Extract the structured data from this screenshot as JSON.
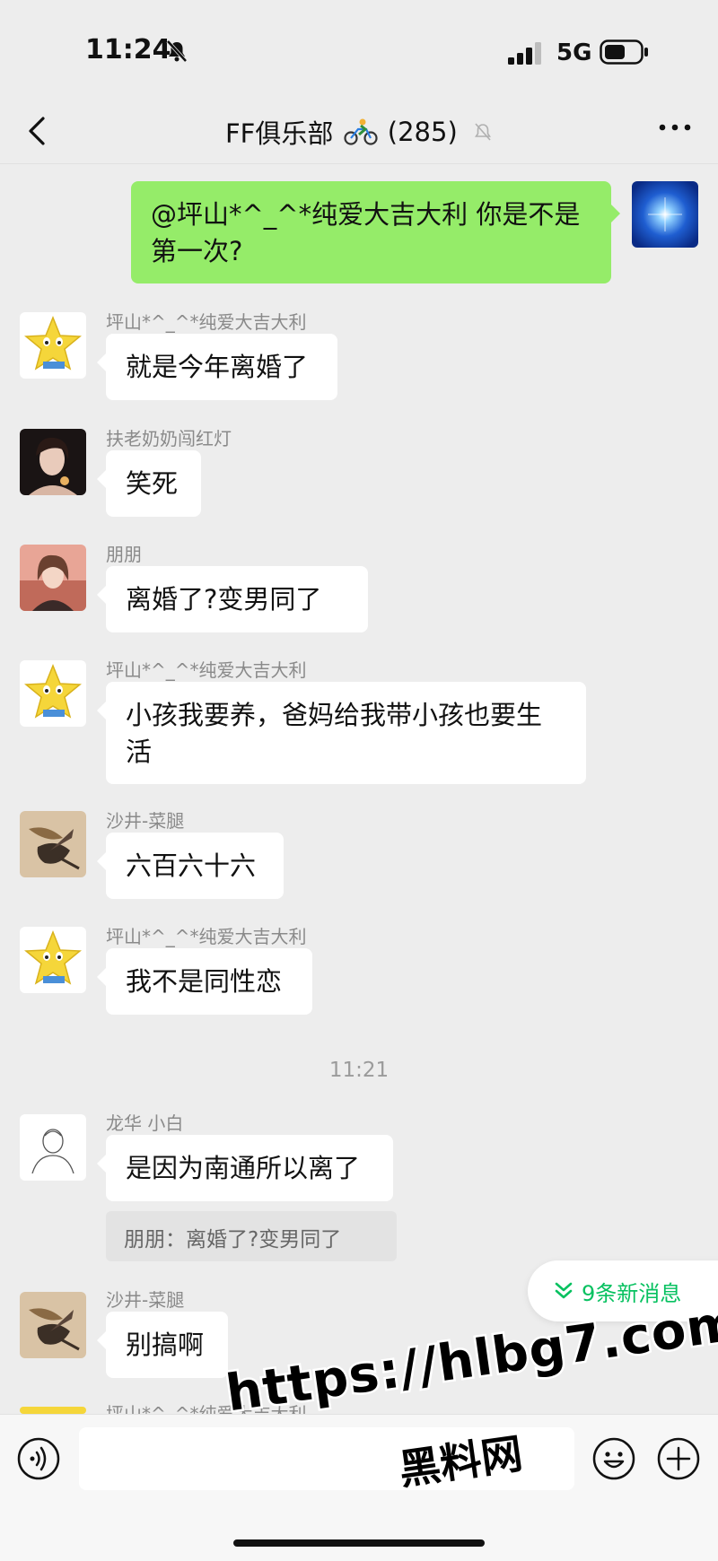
{
  "status_bar": {
    "time": "11:24",
    "network": "5G"
  },
  "header": {
    "title": "FF俱乐部",
    "member_count": "(285)"
  },
  "messages": [
    {
      "sender": "",
      "text": "@坪山*^_^*纯爱大吉大利  你是不是第一次?",
      "self": true
    },
    {
      "sender": "坪山*^_^*纯爱大吉大利",
      "text": "就是今年离婚了"
    },
    {
      "sender": "扶老奶奶闯红灯",
      "text": "笑死"
    },
    {
      "sender": "朋朋",
      "text": "离婚了?变男同了"
    },
    {
      "sender": "坪山*^_^*纯爱大吉大利",
      "text": "小孩我要养，爸妈给我带小孩也要生活"
    },
    {
      "sender": "沙井-菜腿",
      "text": "六百六十六"
    },
    {
      "sender": "坪山*^_^*纯爱大吉大利",
      "text": "我不是同性恋"
    },
    {
      "sender": "龙华  小白",
      "text": "是因为南通所以离了",
      "quote": "朋朋：离婚了?变男同了"
    },
    {
      "sender": "沙井-菜腿",
      "text": "别搞啊"
    },
    {
      "sender": "坪山*^_^*纯爱大吉大利",
      "text": ""
    }
  ],
  "timestamp": "11:21",
  "new_messages": "9条新消息",
  "watermark": {
    "url": "https://hlbg7.com",
    "text": "黑料网"
  },
  "colors": {
    "bubble_self": "#95ec69",
    "accent": "#07c160",
    "background": "#ededed"
  }
}
